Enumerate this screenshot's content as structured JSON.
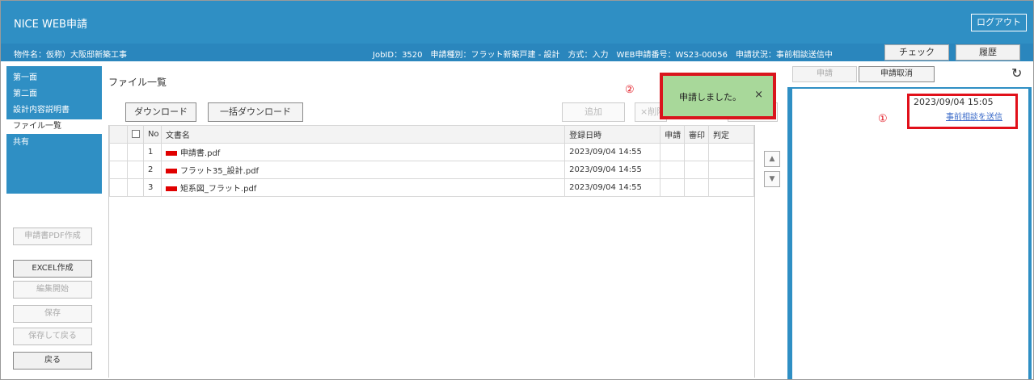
{
  "header": {
    "title": "NICE WEB申請",
    "logout_label": "ログアウト"
  },
  "infobar": {
    "property": "物件名：仮称）大阪邸新築工事",
    "details": "JobID：3520　申請種別：フラット新築戸建 - 設計　方式：入力　WEB申請番号：WS23-00056　申請状況：事前相談送信中",
    "check_label": "チェック",
    "history_label": "履歴"
  },
  "sidebar": {
    "items": [
      {
        "label": "第一面"
      },
      {
        "label": "第二面"
      },
      {
        "label": "設計内容説明書"
      },
      {
        "label": "ファイル一覧"
      },
      {
        "label": "共有"
      }
    ],
    "buttons": {
      "pdf": "申請書PDF作成",
      "excel": "EXCEL作成",
      "edit": "編集開始",
      "save": "保存",
      "save_back": "保存して戻る",
      "back": "戻る"
    }
  },
  "main": {
    "title": "ファイル一覧",
    "download_label": "ダウンロード",
    "bulk_download_label": "一括ダウンロード",
    "add_label": "追加",
    "delete_label": "×削除",
    "columns": {
      "no": "No",
      "name": "文書名",
      "date": "登録日時",
      "apply": "申請",
      "seal": "審印",
      "judge": "判定"
    },
    "files": [
      {
        "no": "1",
        "name": "申請書.pdf",
        "date": "2023/09/04 14:55"
      },
      {
        "no": "2",
        "name": "フラット35_設計.pdf",
        "date": "2023/09/04 14:55"
      },
      {
        "no": "3",
        "name": "矩系図_フラット.pdf",
        "date": "2023/09/04 14:55"
      }
    ]
  },
  "right": {
    "apply_label": "申請",
    "cancel_label": "申請取消",
    "timestamp": "2023/09/04 15:05",
    "send_link": "事前相談を送信",
    "marker": "①"
  },
  "toast": {
    "message": "申請しました。",
    "close": "×",
    "marker": "②"
  },
  "colors": {
    "header_blue": "#2f8fc4",
    "highlight_red": "#e1101a",
    "toast_green": "#a8d89a"
  }
}
